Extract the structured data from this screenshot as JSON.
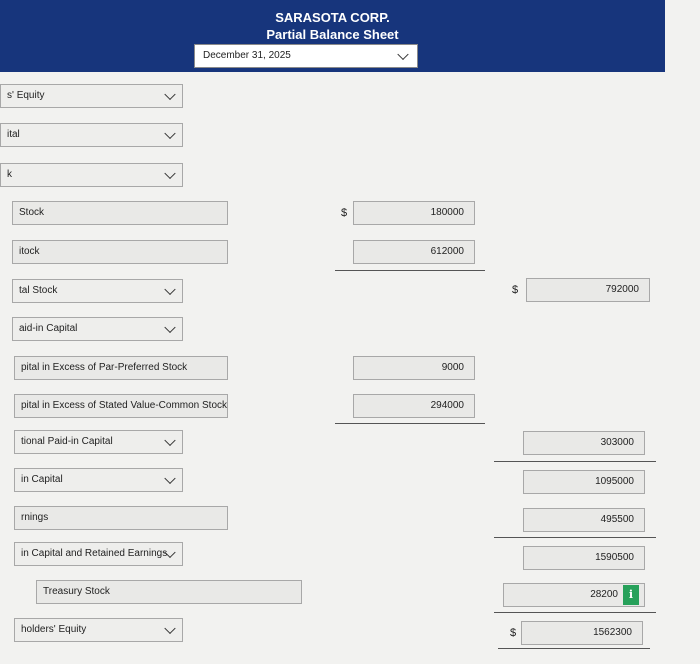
{
  "header": {
    "company": "SARASOTA CORP.",
    "title": "Partial Balance Sheet",
    "date_select": "December 31, 2025"
  },
  "rows": {
    "r1": "s' Equity",
    "r2": "ital",
    "r3": "k",
    "r4": "Stock",
    "r5": "itock",
    "r6": "tal Stock",
    "r7": "aid-in Capital",
    "r8": "pital in Excess of Par-Preferred Stock",
    "r9": "pital in Excess of Stated Value-Common Stock",
    "r10": "tional Paid-in Capital",
    "r11": "in Capital",
    "r12": "rnings",
    "r13": "in Capital and Retained Earnings",
    "r14": "Treasury Stock",
    "r15": "holders' Equity"
  },
  "amounts": {
    "preferred_stock": "180000",
    "common_stock": "612000",
    "total_capital_stock": "792000",
    "excess_preferred": "9000",
    "excess_common": "294000",
    "total_additional_paid_in": "303000",
    "total_paid_in_capital": "1095000",
    "retained_earnings": "495500",
    "total_paid_in_and_retained": "1590500",
    "treasury_stock": "28200",
    "total_stockholders_equity": "1562300"
  },
  "symbols": {
    "dollar": "$",
    "info": "i"
  },
  "colors": {
    "header_bg": "#17357c",
    "info_green": "#27a15a"
  }
}
